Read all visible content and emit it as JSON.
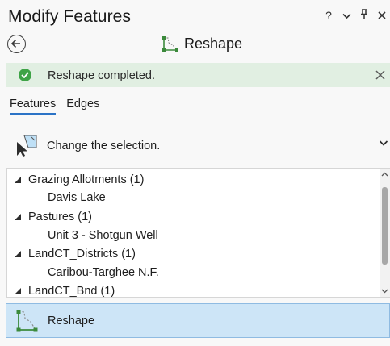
{
  "header": {
    "title": "Modify Features",
    "help_label": "?",
    "controls": [
      "help",
      "options-menu",
      "pin",
      "close"
    ]
  },
  "tool": {
    "name": "Reshape",
    "icon": "reshape-icon"
  },
  "banner": {
    "message": "Reshape completed.",
    "status_color": "#3ea346",
    "background": "#e1efe2"
  },
  "tabs": [
    {
      "label": "Features",
      "active": true
    },
    {
      "label": "Edges",
      "active": false
    }
  ],
  "selection": {
    "label": "Change the selection."
  },
  "tree": {
    "rows": [
      {
        "text": "Grazing Allotments (1)",
        "level": 0
      },
      {
        "text": "Davis Lake",
        "level": 1
      },
      {
        "text": "Pastures (1)",
        "level": 0
      },
      {
        "text": "Unit 3 - Shotgun Well",
        "level": 1
      },
      {
        "text": "LandCT_Districts (1)",
        "level": 0
      },
      {
        "text": "Caribou-Targhee N.F.",
        "level": 1
      },
      {
        "text": "LandCT_Bnd (1)",
        "level": 0
      }
    ]
  },
  "tool_row": {
    "label": "Reshape",
    "selected_color": "#cde5f7"
  },
  "accent_color": "#2b73c6"
}
